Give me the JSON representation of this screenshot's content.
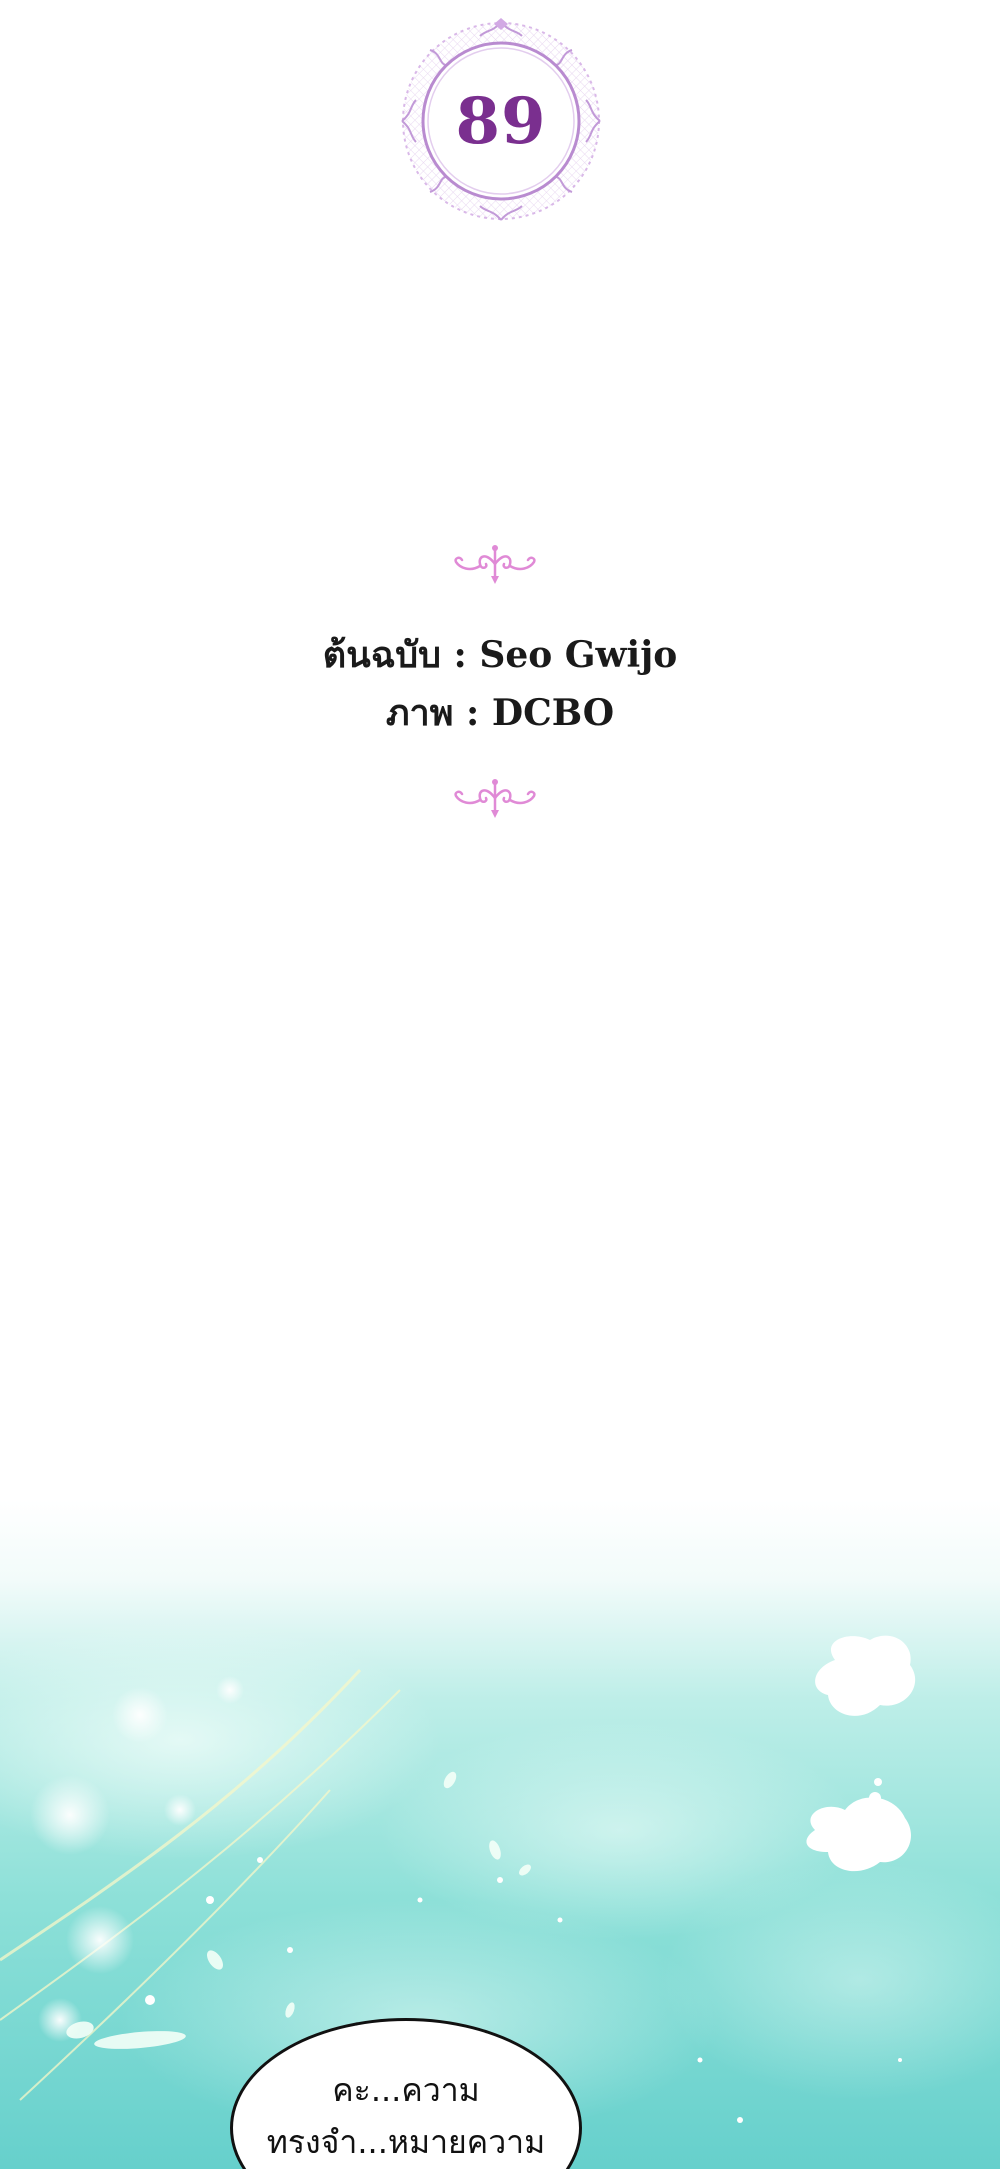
{
  "chapter": {
    "number": "89",
    "frame_color": "#c9a3df",
    "number_color": "#7a2f8f"
  },
  "ornament": {
    "icon": "pink-flourish-ornament",
    "color": "#e08ad6"
  },
  "credits": {
    "story": "ต้นฉบับ : Seo Gwijo",
    "art": "ภาพ : DCBO"
  },
  "scene": {
    "palette": [
      "#ffffff",
      "#bfeee8",
      "#7fdcd4",
      "#5cc9c9"
    ]
  },
  "dialogue": {
    "line1": "คะ...ความ",
    "line2": "ทรงจำ...หมายความ"
  }
}
